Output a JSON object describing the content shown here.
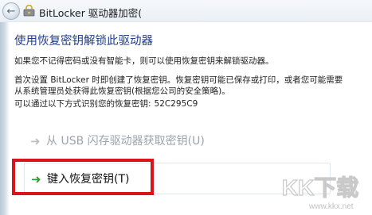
{
  "window": {
    "title": "BitLocker 驱动器加密(",
    "back_icon": "back-arrow-icon",
    "app_icon": "bitlocker-icon"
  },
  "main": {
    "heading": "使用恢复密钥解锁此驱动器",
    "para1": "如果您不记得密码或没有智能卡，则可以使用恢复密钥来解锁驱动器。",
    "para2_line1": "首次设置 BitLocker 时即创建了恢复密钥。恢复密钥可能已保存或打印，或者您可能需要",
    "para2_line2": "从系统管理员处获得此恢复密钥(根据您公司的安全策略)。",
    "para3_label": "可以通过以下方式识别您的恢复密钥:",
    "para3_key": "52C295C9"
  },
  "options": {
    "usb_label": "从 USB 闪存驱动器获取密钥(U)",
    "usb_icon": "arrow-right-icon",
    "key_label": "键入恢复密钥(T)",
    "key_icon": "green-arrow-icon"
  },
  "watermark": {
    "logo_text": "KK下载",
    "url": "www.kkx.net"
  },
  "colors": {
    "heading": "#1e3d8f",
    "highlight": "#d9141b",
    "arrow_active": "#2f9a2f",
    "option_disabled": "#9aa3ad"
  }
}
